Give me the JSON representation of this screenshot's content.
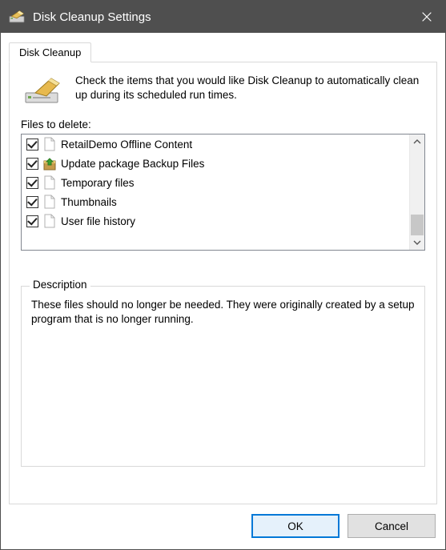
{
  "window": {
    "title": "Disk Cleanup Settings"
  },
  "tab": {
    "label": "Disk Cleanup"
  },
  "intro": {
    "text": "Check the items that you would like Disk Cleanup to automatically clean up during its scheduled run times."
  },
  "files_label": "Files to delete:",
  "items": [
    {
      "label": "RetailDemo Offline Content",
      "checked": true,
      "icon": "file"
    },
    {
      "label": "Update package Backup Files",
      "checked": true,
      "icon": "update"
    },
    {
      "label": "Temporary files",
      "checked": true,
      "icon": "file"
    },
    {
      "label": "Thumbnails",
      "checked": true,
      "icon": "file"
    },
    {
      "label": "User file history",
      "checked": true,
      "icon": "file"
    }
  ],
  "description": {
    "legend": "Description",
    "text": "These files should no longer be needed. They were originally created by a setup program that is no longer running."
  },
  "buttons": {
    "ok": "OK",
    "cancel": "Cancel"
  }
}
